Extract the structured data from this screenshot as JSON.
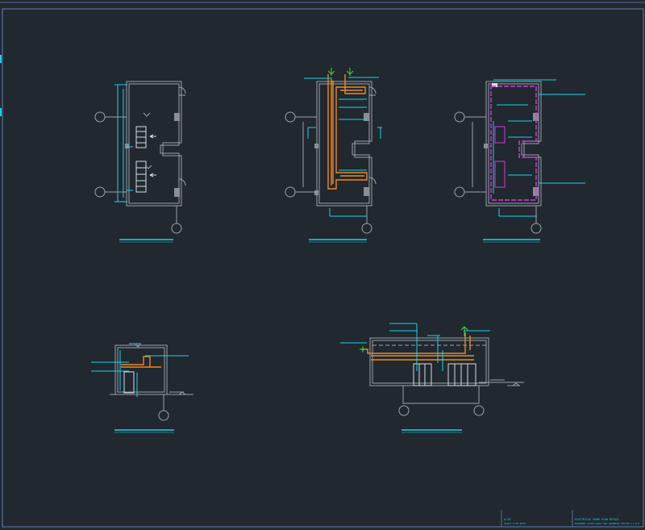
{
  "sheet": {
    "background": "#212830",
    "frame_color": "#5a6e9a",
    "title_block": {
      "left_lines": [
        "A-03",
        "SCALE 1:50  NOTE"
      ],
      "right_lines": [
        "ELECTRICAL ROOM PLAN DETAIL",
        "EQUIPMENT LAYOUT  CABLE TRAY  GROUNDING  SECTION  A-A  B-B"
      ]
    }
  },
  "colors": {
    "wall": "#9aa2ab",
    "dimension": "#15d6e6",
    "cable_tray": "#f08a1c",
    "grounding": "#d23cd6",
    "equipment": "#d8dde2",
    "green_marker": "#3cdc3c",
    "column": "#8a8f94"
  },
  "views": [
    {
      "id": "plan-equipment",
      "kind": "plan"
    },
    {
      "id": "plan-cable-tray",
      "kind": "plan"
    },
    {
      "id": "plan-grounding",
      "kind": "plan"
    },
    {
      "id": "section-a",
      "kind": "section"
    },
    {
      "id": "section-b",
      "kind": "section"
    }
  ]
}
